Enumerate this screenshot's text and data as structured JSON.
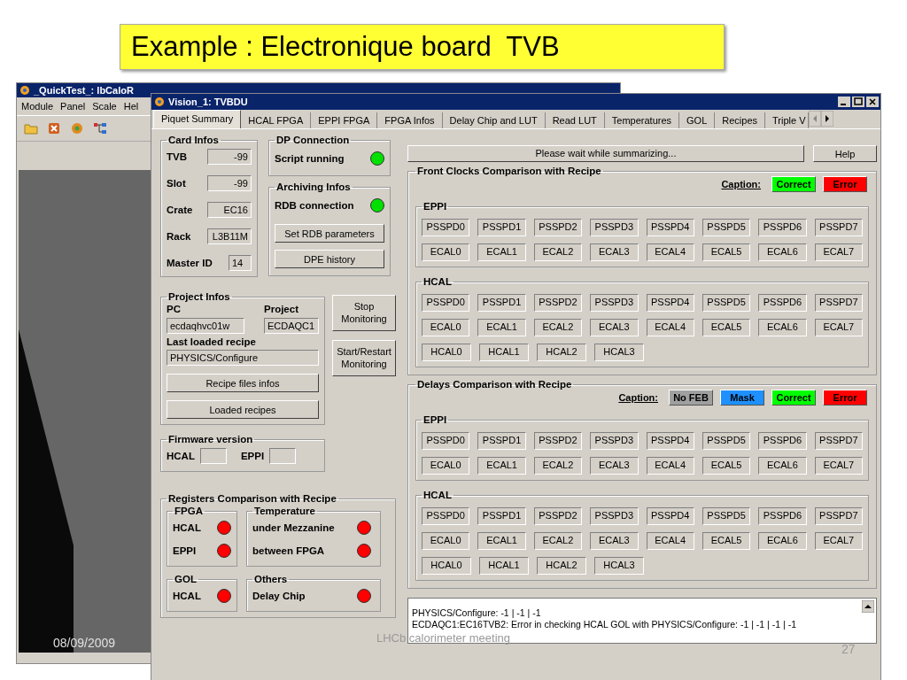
{
  "slide": {
    "title": "Example : Electronique board  TVB",
    "date": "08/09/2009",
    "footer": "LHCb calorimeter meeting",
    "page": "27"
  },
  "back_window": {
    "title": "_QuickTest_: lbCaloR",
    "menu": [
      "Module",
      "Panel",
      "Scale",
      "Hel"
    ]
  },
  "window": {
    "title": "Vision_1: TVBDU",
    "tabs": [
      {
        "label": "Piquet Summary",
        "selected": true
      },
      {
        "label": "HCAL FPGA",
        "selected": false
      },
      {
        "label": "EPPI FPGA",
        "selected": false
      },
      {
        "label": "FPGA Infos",
        "selected": false
      },
      {
        "label": "Delay Chip and LUT",
        "selected": false
      },
      {
        "label": "Read LUT",
        "selected": false
      },
      {
        "label": "Temperatures",
        "selected": false
      },
      {
        "label": "GOL",
        "selected": false
      },
      {
        "label": "Recipes",
        "selected": false
      },
      {
        "label": "Triple V",
        "selected": false
      }
    ]
  },
  "card_infos": {
    "title": "Card Infos",
    "fields": [
      {
        "label": "TVB",
        "value": "-99"
      },
      {
        "label": "Slot",
        "value": "-99"
      },
      {
        "label": "Crate",
        "value": "EC16"
      },
      {
        "label": "Rack",
        "value": "L3B11M"
      },
      {
        "label": "Master ID",
        "value": "14"
      }
    ]
  },
  "dp_connection": {
    "title": "DP Connection",
    "indicators": [
      {
        "label": "Script running",
        "color": "#00e000"
      }
    ]
  },
  "archiving": {
    "title": "Archiving Infos",
    "indicators": [
      {
        "label": "RDB connection",
        "color": "#00e000"
      }
    ],
    "buttons": [
      "Set RDB parameters",
      "DPE history"
    ]
  },
  "project_infos": {
    "title": "Project Infos",
    "pc_label": "PC",
    "pc": "ecdaqhvc01w",
    "project_label": "Project",
    "project": "ECDAQC1",
    "recipe_label": "Last loaded recipe",
    "recipe": "PHYSICS/Configure",
    "buttons": [
      "Recipe files infos",
      "Loaded recipes"
    ]
  },
  "monitor_buttons": [
    "Stop Monitoring",
    "Start/Restart Monitoring"
  ],
  "firmware": {
    "title": "Firmware version",
    "fields": [
      {
        "label": "HCAL"
      },
      {
        "label": "EPPI"
      }
    ]
  },
  "registers": {
    "title": "Registers Comparison with Recipe",
    "groups": [
      {
        "title": "FPGA",
        "items": [
          {
            "label": "HCAL",
            "color": "#ff0000"
          },
          {
            "label": "EPPI",
            "color": "#ff0000"
          }
        ]
      },
      {
        "title": "Temperature",
        "items": [
          {
            "label": "under Mezzanine",
            "color": "#ff0000"
          },
          {
            "label": "between FPGA",
            "color": "#ff0000"
          }
        ]
      },
      {
        "title": "GOL",
        "items": [
          {
            "label": "HCAL",
            "color": "#ff0000"
          }
        ]
      },
      {
        "title": "Others",
        "items": [
          {
            "label": "Delay Chip",
            "color": "#ff0000"
          }
        ]
      }
    ]
  },
  "status": "Please wait while summarizing...",
  "help": "Help",
  "front_clocks": {
    "title": "Front Clocks Comparison with Recipe",
    "caption_label": "Caption:",
    "legend": [
      {
        "label": "Correct",
        "color": "#00ff00"
      },
      {
        "label": "Error",
        "color": "#ff0000"
      }
    ],
    "sections": [
      {
        "title": "EPPI",
        "rows": [
          [
            "PSSPD0",
            "PSSPD1",
            "PSSPD2",
            "PSSPD3",
            "PSSPD4",
            "PSSPD5",
            "PSSPD6",
            "PSSPD7"
          ],
          [
            "ECAL0",
            "ECAL1",
            "ECAL2",
            "ECAL3",
            "ECAL4",
            "ECAL5",
            "ECAL6",
            "ECAL7"
          ]
        ]
      },
      {
        "title": "HCAL",
        "rows": [
          [
            "PSSPD0",
            "PSSPD1",
            "PSSPD2",
            "PSSPD3",
            "PSSPD4",
            "PSSPD5",
            "PSSPD6",
            "PSSPD7"
          ],
          [
            "ECAL0",
            "ECAL1",
            "ECAL2",
            "ECAL3",
            "ECAL4",
            "ECAL5",
            "ECAL6",
            "ECAL7"
          ],
          [
            "HCAL0",
            "HCAL1",
            "HCAL2",
            "HCAL3"
          ]
        ]
      }
    ]
  },
  "delays": {
    "title": "Delays Comparison with Recipe",
    "caption_label": "Caption:",
    "legend": [
      {
        "label": "No FEB",
        "color": "#a0a0a0"
      },
      {
        "label": "Mask",
        "color": "#1e90ff"
      },
      {
        "label": "Correct",
        "color": "#00ff00"
      },
      {
        "label": "Error",
        "color": "#ff0000"
      }
    ],
    "sections": [
      {
        "title": "EPPI",
        "rows": [
          [
            "PSSPD0",
            "PSSPD1",
            "PSSPD2",
            "PSSPD3",
            "PSSPD4",
            "PSSPD5",
            "PSSPD6",
            "PSSPD7"
          ],
          [
            "ECAL0",
            "ECAL1",
            "ECAL2",
            "ECAL3",
            "ECAL4",
            "ECAL5",
            "ECAL6",
            "ECAL7"
          ]
        ]
      },
      {
        "title": "HCAL",
        "rows": [
          [
            "PSSPD0",
            "PSSPD1",
            "PSSPD2",
            "PSSPD3",
            "PSSPD4",
            "PSSPD5",
            "PSSPD6",
            "PSSPD7"
          ],
          [
            "ECAL0",
            "ECAL1",
            "ECAL2",
            "ECAL3",
            "ECAL4",
            "ECAL5",
            "ECAL6",
            "ECAL7"
          ],
          [
            "HCAL0",
            "HCAL1",
            "HCAL2",
            "HCAL3"
          ]
        ]
      }
    ]
  },
  "log": [
    "PHYSICS/Configure: -1 | -1 | -1",
    "ECDAQC1:EC16TVB2: Error in checking HCAL GOL with PHYSICS/Configure: -1 | -1 | -1 | -1"
  ]
}
